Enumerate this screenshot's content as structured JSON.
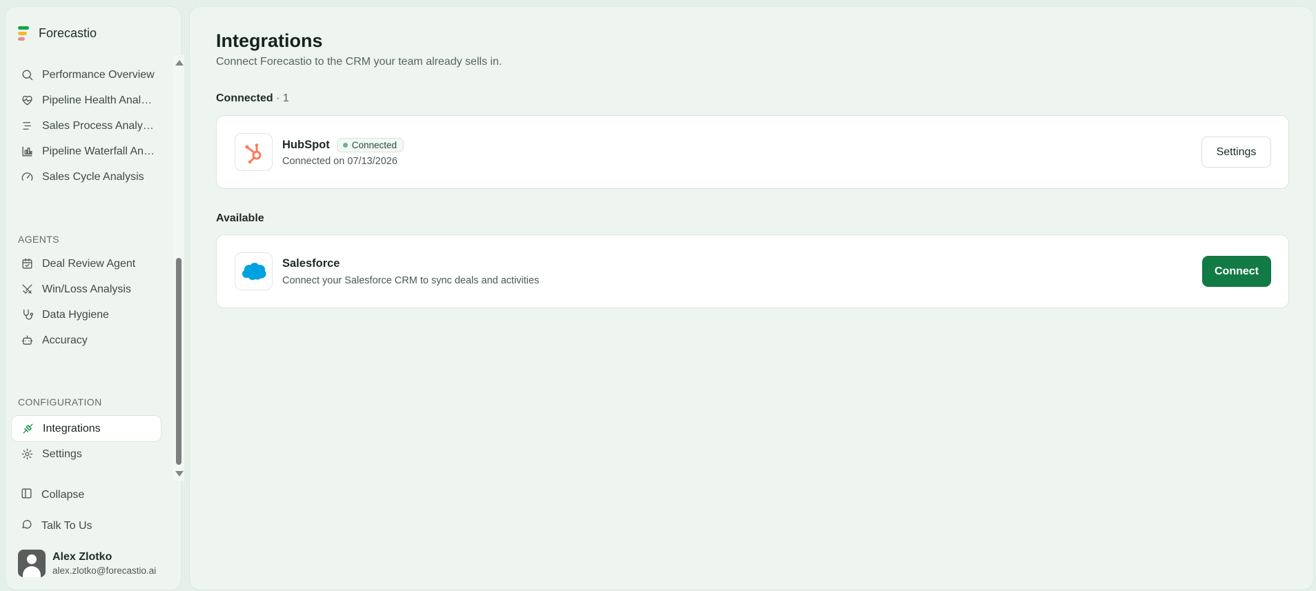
{
  "brand": {
    "name": "Forecastio"
  },
  "sidebar": {
    "analytics_items": [
      {
        "label": "Performance Overview",
        "icon": "search-icon"
      },
      {
        "label": "Pipeline Health Analysis",
        "icon": "heart-pulse-icon"
      },
      {
        "label": "Sales Process Analysis",
        "icon": "list-indent-icon"
      },
      {
        "label": "Pipeline Waterfall Analysis",
        "icon": "bar-chart-icon"
      },
      {
        "label": "Sales Cycle Analysis",
        "icon": "gauge-icon"
      }
    ],
    "agents_label": "AGENTS",
    "agents_items": [
      {
        "label": "Deal Review Agent",
        "icon": "calendar-check-icon"
      },
      {
        "label": "Win/Loss Analysis",
        "icon": "swords-icon"
      },
      {
        "label": "Data Hygiene",
        "icon": "stethoscope-icon"
      },
      {
        "label": "Accuracy",
        "icon": "bot-icon"
      }
    ],
    "configuration_label": "CONFIGURATION",
    "configuration_items": [
      {
        "label": "Integrations",
        "icon": "plug-icon",
        "active": true
      },
      {
        "label": "Settings",
        "icon": "gear-icon"
      }
    ],
    "bottom_items": [
      {
        "label": "Collapse",
        "icon": "sidebar-panel-icon"
      },
      {
        "label": "Talk To Us",
        "icon": "chat-bubble-icon"
      }
    ],
    "user": {
      "name": "Alex Zlotko",
      "email": "alex.zlotko@forecastio.ai"
    }
  },
  "main": {
    "title": "Integrations",
    "subtitle": "Connect Forecastio to the CRM your team already sells in.",
    "connected_group": {
      "label": "Connected",
      "count": " · 1"
    },
    "available_group": {
      "label": "Available"
    },
    "connected": [
      {
        "name": "HubSpot",
        "badge": "Connected",
        "description": "Connected on 07/13/2026",
        "button": "Settings",
        "logo": "hubspot-logo-icon",
        "color": "#ff7a59"
      }
    ],
    "available": [
      {
        "name": "Salesforce",
        "description": "Connect your Salesforce CRM to sync deals and activities",
        "button": "Connect",
        "logo": "salesforce-logo-icon",
        "color": "#00a1e0"
      }
    ]
  },
  "colors": {
    "accent": "#127a44",
    "background": "#eef5f0",
    "badge_dot": "#6fb087"
  }
}
